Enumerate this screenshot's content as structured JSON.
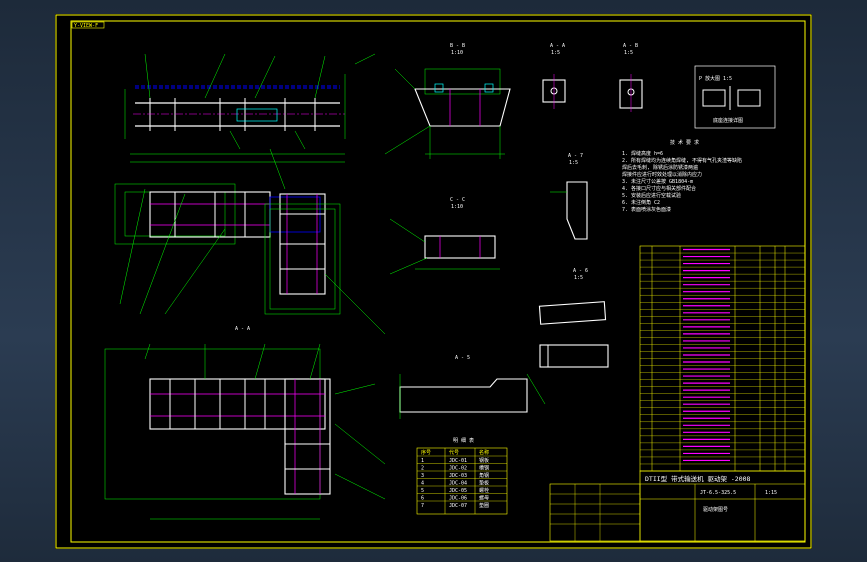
{
  "frame_tag": "Y-VIEW-F",
  "view_labels": {
    "section_a": "B - B",
    "section_a_scale": "1:10",
    "section_b": "A - A",
    "section_b_scale": "1:5",
    "section_c": "A - B",
    "section_c_scale": "1:5",
    "section_d": "C - C",
    "section_d_scale": "1:10",
    "section_e": "A - 7",
    "section_e_scale": "1:5",
    "section_f": "A - 6",
    "section_f_scale": "1:5",
    "section_g": "A - 5",
    "view_mid": "A - A"
  },
  "notes_title": "技 术 要 求",
  "notes": [
    "1. 焊缝高度 h=6",
    "2. 所有焊缝均为连续角焊缝, 不得有气孔夹渣等缺陷",
    "   焊后去毛刺, 除锈后涂防锈漆两遍",
    "   焊接件应进行时效处理以消除内应力",
    "3. 未注尺寸公差按 GB1804-m",
    "4. 各接口尺寸应与相关部件配合",
    "5. 安装后应进行空载试验",
    "6. 未注倒角 C2",
    "7. 表面喷涂灰色面漆"
  ],
  "detail_box_title": "P 放大图 1:5",
  "detail_box_caption": "底座连接详图",
  "parts_table": {
    "title": "明 细 表",
    "headers": [
      "序号",
      "代号",
      "名称"
    ],
    "rows": [
      [
        "1",
        "JDC-01",
        "钢板"
      ],
      [
        "2",
        "JDC-02",
        "槽钢"
      ],
      [
        "3",
        "JDC-03",
        "角钢"
      ],
      [
        "4",
        "JDC-04",
        "垫板"
      ],
      [
        "5",
        "JDC-05",
        "螺栓"
      ],
      [
        "6",
        "JDC-06",
        "螺母"
      ],
      [
        "7",
        "JDC-07",
        "垫圈"
      ]
    ]
  },
  "title_block": {
    "main_title": "DTII型 带式输送机 驱动架 -2008",
    "drawing_no": "JT-6.5-325.5",
    "scale": "1:15",
    "weight": "驱动架图号"
  },
  "bom_rows": 32,
  "colors": {
    "frame": "#ffff00",
    "geometry": "#ffffff",
    "centerline": "#ff00ff",
    "dimension": "#00ff00",
    "section": "#00ffff",
    "hidden": "#0000ff"
  }
}
